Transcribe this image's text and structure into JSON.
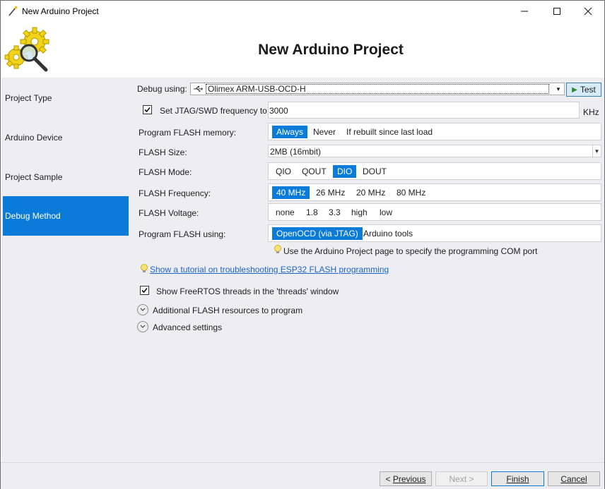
{
  "window": {
    "title": "New Arduino Project"
  },
  "header": {
    "heading": "New Arduino Project",
    "logo_icon": "gears-magnifier-icon"
  },
  "sidebar": {
    "items": [
      {
        "label": "Project Type",
        "active": false
      },
      {
        "label": "Arduino Device",
        "active": false
      },
      {
        "label": "Project Sample",
        "active": false
      },
      {
        "label": "Debug Method",
        "active": true
      }
    ]
  },
  "debug": {
    "debug_using_label": "Debug using:",
    "debug_using_value": "Olimex ARM-USB-OCD-H",
    "test_label": "Test",
    "jtag_checkbox_label": "Set JTAG/SWD frequency to:",
    "jtag_checked": true,
    "jtag_value": "3000",
    "jtag_unit": "KHz",
    "program_flash_label": "Program FLASH memory:",
    "program_flash_options": [
      "Always",
      "Never",
      "If rebuilt since last load"
    ],
    "program_flash_selected": "Always",
    "flash_size_label": "FLASH Size:",
    "flash_size_value": "2MB (16mbit)",
    "flash_mode_label": "FLASH Mode:",
    "flash_mode_options": [
      "QIO",
      "QOUT",
      "DIO",
      "DOUT"
    ],
    "flash_mode_selected": "DIO",
    "flash_freq_label": "FLASH Frequency:",
    "flash_freq_options": [
      "40 MHz",
      "26 MHz",
      "20 MHz",
      "80 MHz"
    ],
    "flash_freq_selected": "40 MHz",
    "flash_voltage_label": "FLASH Voltage:",
    "flash_voltage_options": [
      "none",
      "1.8",
      "3.3",
      "high",
      "low"
    ],
    "program_using_label": "Program FLASH using:",
    "program_using_options": [
      "OpenOCD (via JTAG)",
      "Arduino tools"
    ],
    "program_using_selected": "OpenOCD (via JTAG)",
    "hint": "Use the Arduino Project page to specify the programming COM port",
    "tutorial_link": "Show a tutorial on troubleshooting ESP32 FLASH programming",
    "freertos_label": "Show FreeRTOS threads in the 'threads' window",
    "freertos_checked": true,
    "additional_flash_label": "Additional FLASH resources to program",
    "advanced_label": "Advanced settings"
  },
  "footer": {
    "previous": "Previous",
    "next": "Next",
    "finish": "Finish",
    "cancel": "Cancel"
  },
  "colors": {
    "accent": "#0a7bd8",
    "panel": "#eeeef2",
    "link": "#1a64c8"
  }
}
